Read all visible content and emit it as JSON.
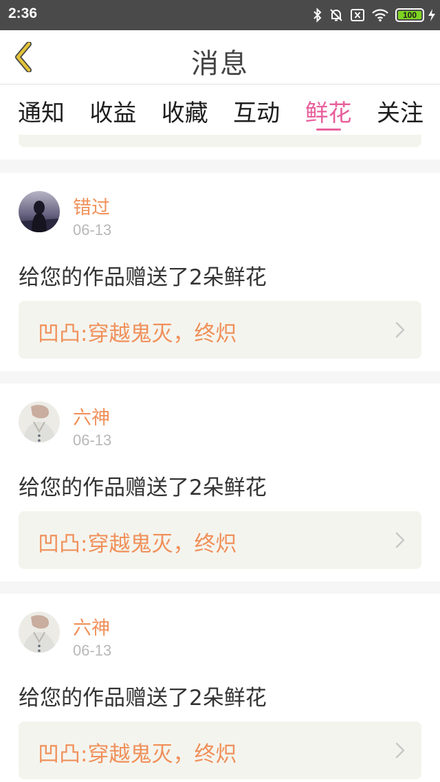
{
  "status_bar": {
    "time": "2:36",
    "battery": "100"
  },
  "header": {
    "title": "消息"
  },
  "tabs": [
    {
      "label": "通知",
      "active": false
    },
    {
      "label": "收益",
      "active": false
    },
    {
      "label": "收藏",
      "active": false
    },
    {
      "label": "互动",
      "active": false
    },
    {
      "label": "鲜花",
      "active": true
    },
    {
      "label": "关注",
      "active": false
    }
  ],
  "messages": [
    {
      "username": "错过",
      "date": "06-13",
      "text": "给您的作品赠送了2朵鲜花",
      "work_title": "凹凸:穿越鬼灭，终炽",
      "avatar": "avatar-dark"
    },
    {
      "username": "六神",
      "date": "06-13",
      "text": "给您的作品赠送了2朵鲜花",
      "work_title": "凹凸:穿越鬼灭，终炽",
      "avatar": "avatar-light"
    },
    {
      "username": "六神",
      "date": "06-13",
      "text": "给您的作品赠送了2朵鲜花",
      "work_title": "凹凸:穿越鬼灭，终炽",
      "avatar": "avatar-light"
    }
  ],
  "colors": {
    "accent": "#e8609c",
    "username": "#f0905a",
    "back_arrow": "#e2c23a",
    "battery": "#7ed321"
  }
}
